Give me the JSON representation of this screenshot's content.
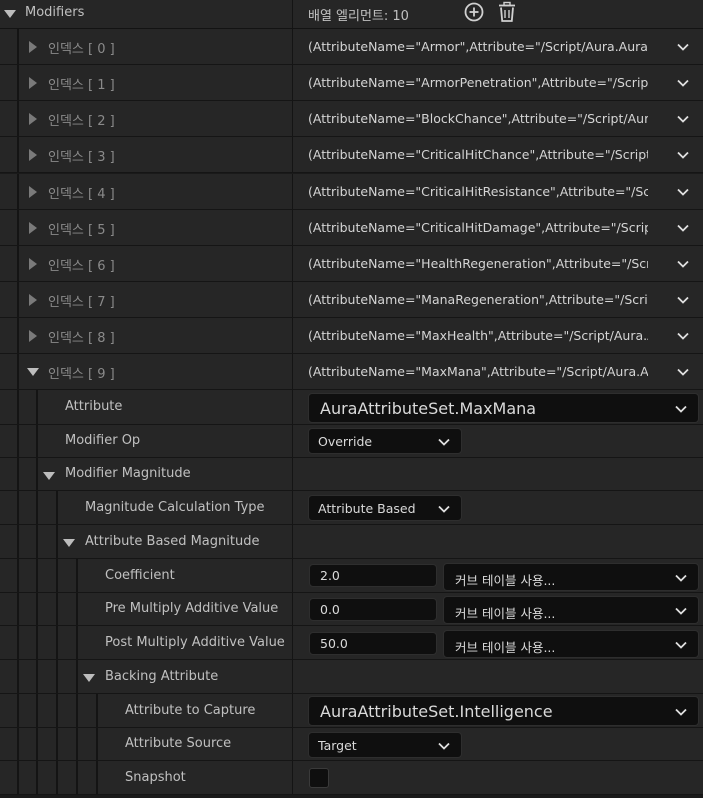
{
  "header": {
    "title": "Modifiers",
    "element_count": "배열 엘리먼트: 10",
    "add_icon": "circle-plus-icon",
    "delete_icon": "trash-icon"
  },
  "array_items": [
    {
      "label": "인덱스 [ 0 ]",
      "value": "(AttributeName=\"Armor\",Attribute=\"/Script/Aura.AuraAttribu"
    },
    {
      "label": "인덱스 [ 1 ]",
      "value": "(AttributeName=\"ArmorPenetration\",Attribute=\"/Script/Aura."
    },
    {
      "label": "인덱스 [ 2 ]",
      "value": "(AttributeName=\"BlockChance\",Attribute=\"/Script/Aura.Aura"
    },
    {
      "label": "인덱스 [ 3 ]",
      "value": "(AttributeName=\"CriticalHitChance\",Attribute=\"/Script/Aura.A"
    },
    {
      "label": "인덱스 [ 4 ]",
      "value": "(AttributeName=\"CriticalHitResistance\",Attribute=\"/Script/Au"
    },
    {
      "label": "인덱스 [ 5 ]",
      "value": "(AttributeName=\"CriticalHitDamage\",Attribute=\"/Script/Aura"
    },
    {
      "label": "인덱스 [ 6 ]",
      "value": "(AttributeName=\"HealthRegeneration\",Attribute=\"/Script/Aur"
    },
    {
      "label": "인덱스 [ 7 ]",
      "value": "(AttributeName=\"ManaRegeneration\",Attribute=\"/Script/Aura"
    },
    {
      "label": "인덱스 [ 8 ]",
      "value": "(AttributeName=\"MaxHealth\",Attribute=\"/Script/Aura.AuraAt"
    },
    {
      "label": "인덱스 [ 9 ]",
      "value": "(AttributeName=\"MaxMana\",Attribute=\"/Script/Aura.AuraAttri"
    }
  ],
  "expanded": {
    "attribute_label": "Attribute",
    "attribute_value": "AuraAttributeSet.MaxMana",
    "modifier_op_label": "Modifier Op",
    "modifier_op_value": "Override",
    "modifier_magnitude_label": "Modifier Magnitude",
    "calc_type_label": "Magnitude Calculation Type",
    "calc_type_value": "Attribute Based",
    "attr_based_label": "Attribute Based Magnitude",
    "coefficient_label": "Coefficient",
    "coefficient_value": "2.0",
    "pre_mult_label": "Pre Multiply Additive Value",
    "pre_mult_value": "0.0",
    "post_mult_label": "Post Multiply Additive Value",
    "post_mult_value": "50.0",
    "curve_table_text": "커브 테이블 사용...",
    "backing_label": "Backing Attribute",
    "capture_label": "Attribute to Capture",
    "capture_value": "AuraAttributeSet.Intelligence",
    "source_label": "Attribute Source",
    "source_value": "Target",
    "snapshot_label": "Snapshot",
    "snapshot_checked": false
  }
}
